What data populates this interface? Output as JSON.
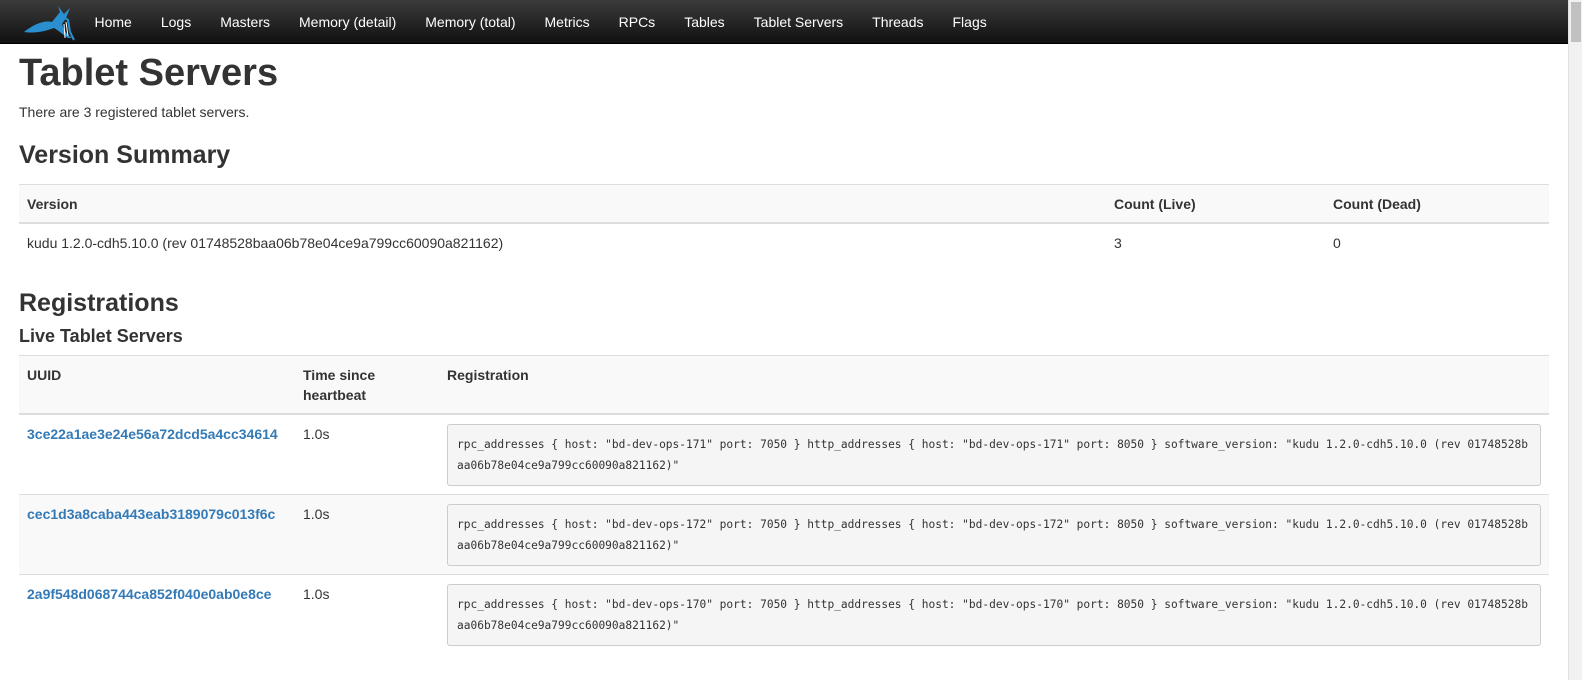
{
  "nav": {
    "links": [
      "Home",
      "Logs",
      "Masters",
      "Memory (detail)",
      "Memory (total)",
      "Metrics",
      "RPCs",
      "Tables",
      "Tablet Servers",
      "Threads",
      "Flags"
    ]
  },
  "page": {
    "title": "Tablet Servers",
    "intro": "There are 3 registered tablet servers."
  },
  "version_summary": {
    "heading": "Version Summary",
    "columns": [
      "Version",
      "Count (Live)",
      "Count (Dead)"
    ],
    "rows": [
      {
        "version": "kudu 1.2.0-cdh5.10.0 (rev 01748528baa06b78e04ce9a799cc60090a821162)",
        "live": "3",
        "dead": "0"
      }
    ]
  },
  "registrations": {
    "heading": "Registrations",
    "live_heading": "Live Tablet Servers",
    "columns": [
      "UUID",
      "Time since heartbeat",
      "Registration"
    ],
    "rows": [
      {
        "uuid": "3ce22a1ae3e24e56a72dcd5a4cc34614",
        "heartbeat": "1.0s",
        "registration": "rpc_addresses { host: \"bd-dev-ops-171\" port: 7050 } http_addresses { host: \"bd-dev-ops-171\" port: 8050 } software_version: \"kudu 1.2.0-cdh5.10.0 (rev 01748528baa06b78e04ce9a799cc60090a821162)\""
      },
      {
        "uuid": "cec1d3a8caba443eab3189079c013f6c",
        "heartbeat": "1.0s",
        "registration": "rpc_addresses { host: \"bd-dev-ops-172\" port: 7050 } http_addresses { host: \"bd-dev-ops-172\" port: 8050 } software_version: \"kudu 1.2.0-cdh5.10.0 (rev 01748528baa06b78e04ce9a799cc60090a821162)\""
      },
      {
        "uuid": "2a9f548d068744ca852f040e0ab0e8ce",
        "heartbeat": "1.0s",
        "registration": "rpc_addresses { host: \"bd-dev-ops-170\" port: 7050 } http_addresses { host: \"bd-dev-ops-170\" port: 8050 } software_version: \"kudu 1.2.0-cdh5.10.0 (rev 01748528baa06b78e04ce9a799cc60090a821162)\""
      }
    ]
  },
  "colors": {
    "link": "#337ab7",
    "navbar": "#222222",
    "logo": "#2a8fd0"
  },
  "icons": {
    "logo": "kudu-antelope-logo-icon"
  }
}
